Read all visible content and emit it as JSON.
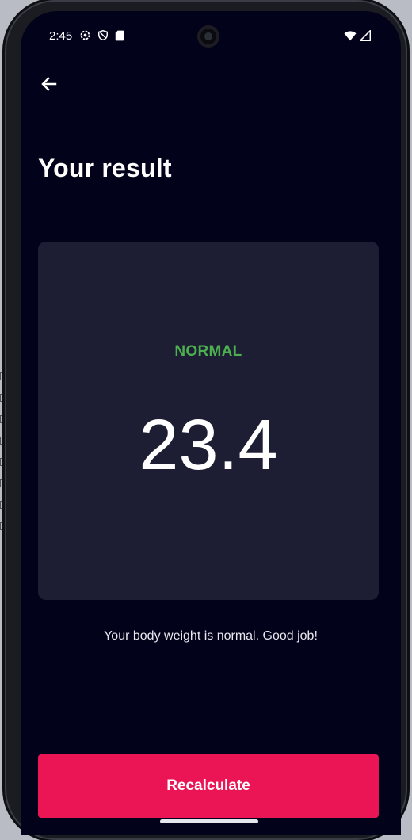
{
  "status_bar": {
    "time": "2:45",
    "icons_left": [
      "settings-icon",
      "shield-icon",
      "sd-card-icon"
    ],
    "icons_right": [
      "wifi-icon",
      "signal-icon"
    ]
  },
  "nav": {
    "back_icon": "arrow-back-icon"
  },
  "page": {
    "title": "Your result"
  },
  "result": {
    "category": "NORMAL",
    "category_color": "#4caf50",
    "bmi": "23.4",
    "interpretation": "Your body weight is normal. Good job!"
  },
  "actions": {
    "recalculate_label": "Recalculate",
    "button_color": "#eb1555"
  },
  "theme": {
    "background": "#03021b",
    "card": "#1d1e33"
  }
}
